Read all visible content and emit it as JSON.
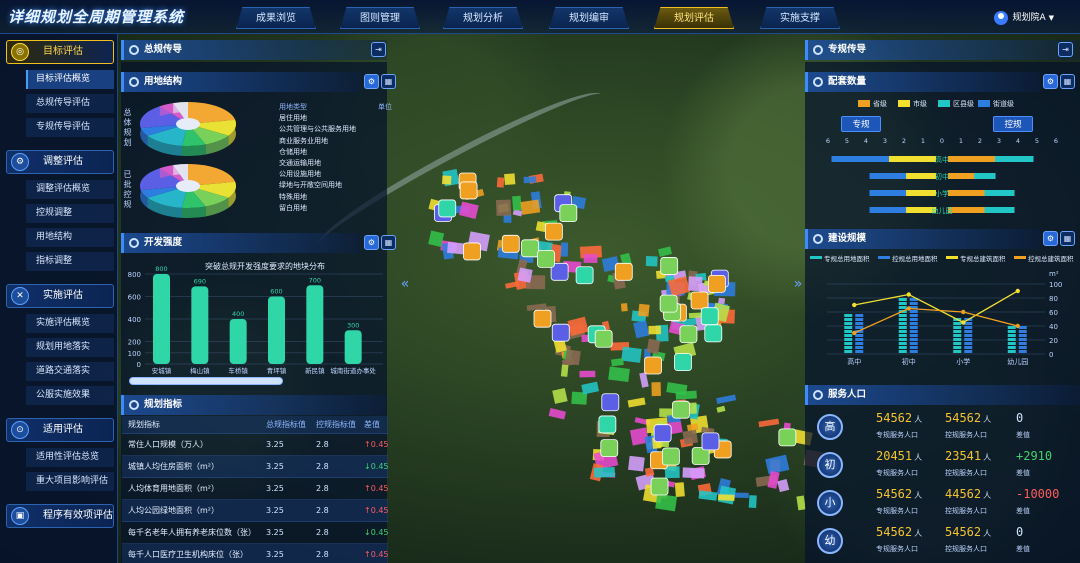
{
  "app_title": "详细规划全周期管理系统",
  "nav": [
    "成果浏览",
    "图则管理",
    "规划分析",
    "规划编审",
    "规划评估",
    "实施支撑"
  ],
  "nav_active": 4,
  "user": "规划院A",
  "sidebar": [
    {
      "label": "目标评估",
      "icon": "target-icon",
      "glyph": "◎",
      "active": true,
      "items": [
        "目标评估概览",
        "总规传导评估",
        "专规传导评估"
      ],
      "active_item": 0
    },
    {
      "label": "调整评估",
      "icon": "adjust-icon",
      "glyph": "⚙",
      "active": false,
      "items": [
        "调整评估概览",
        "控规调整",
        "用地结构",
        "指标调整"
      ]
    },
    {
      "label": "实施评估",
      "icon": "tools-icon",
      "glyph": "✕",
      "active": false,
      "items": [
        "实施评估概览",
        "规划用地落实",
        "道路交通落实",
        "公服实施效果"
      ]
    },
    {
      "label": "适用评估",
      "icon": "fit-icon",
      "glyph": "⊙",
      "active": false,
      "items": [
        "适用性评估总览",
        "重大项目影响评估"
      ]
    },
    {
      "label": "程序有效项评估",
      "icon": "process-icon",
      "glyph": "▣",
      "active": false,
      "items": []
    }
  ],
  "left": {
    "zongguiheader": "总规传导",
    "landuse_header": "用地结构",
    "pie_label_top": "总体规划",
    "pie_label_bottom": "已批控规",
    "legend_heading": "用地类型",
    "legend_value_heading": "单位",
    "land_types": [
      "居住用地",
      "公共管理与公共服务用地",
      "商业服务业用地",
      "仓储用地",
      "交通运输用地",
      "公用设施用地",
      "绿地与开敞空间用地",
      "特殊用地",
      "留白用地"
    ],
    "intensity_header": "开发强度",
    "intensity_title": "突破总规开发强度要求的地块分布",
    "kpi_header": "规划指标",
    "kpi_columns": [
      "规划指标",
      "总规指标值",
      "控规指标值",
      "差值"
    ],
    "kpi_rows": [
      {
        "name": "常住人口规模（万人）",
        "a": "3.25",
        "b": "2.8",
        "diff": "0.45",
        "trend": "up"
      },
      {
        "name": "城镇人均住房面积（m²）",
        "a": "3.25",
        "b": "2.8",
        "diff": "0.45",
        "trend": "down"
      },
      {
        "name": "人均体育用地面积（m²）",
        "a": "3.25",
        "b": "2.8",
        "diff": "0.45",
        "trend": "up"
      },
      {
        "name": "人均公园绿地面积（m²）",
        "a": "3.25",
        "b": "2.8",
        "diff": "0.45",
        "trend": "up"
      },
      {
        "name": "每千名老年人拥有养老床位数（张）",
        "a": "3.25",
        "b": "2.8",
        "diff": "0.45",
        "trend": "down"
      },
      {
        "name": "每千人口医疗卫生机构床位（张）",
        "a": "3.25",
        "b": "2.8",
        "diff": "0.45",
        "trend": "up"
      }
    ]
  },
  "right": {
    "zhuangui_header": "专规传导",
    "supply_header": "配套数量",
    "supply_legend": [
      {
        "name": "省级",
        "color": "#f0a020"
      },
      {
        "name": "市级",
        "color": "#f2e030"
      },
      {
        "name": "区县级",
        "color": "#22c6c6"
      },
      {
        "name": "街道级",
        "color": "#2e7de0"
      }
    ],
    "btn_left": "专规",
    "btn_right": "控规",
    "scale_ticks": [
      "6",
      "5",
      "4",
      "3",
      "2",
      "1",
      "0",
      "1",
      "2",
      "3",
      "4",
      "5",
      "6"
    ],
    "school_levels": [
      "高中",
      "初中",
      "小学",
      "幼儿园"
    ],
    "scale_header": "建设规模",
    "scale_legend": [
      "专规总用地面积",
      "控规总用地面积",
      "专规总建筑面积",
      "控规总建筑面积"
    ],
    "scale_unit_left": "m²",
    "service_header": "服务人口",
    "service_rows": [
      {
        "badge": "高",
        "a": "54562",
        "b": "54562",
        "diff": "0",
        "diff_color": "#cfe3ff"
      },
      {
        "badge": "初",
        "a": "20451",
        "b": "23541",
        "diff": "+2910",
        "diff_color": "#3fd36b"
      },
      {
        "badge": "小",
        "a": "54562",
        "b": "44562",
        "diff": "-10000",
        "diff_color": "#ff5c5c"
      },
      {
        "badge": "幼",
        "a": "54562",
        "b": "54562",
        "diff": "0",
        "diff_color": "#cfe3ff"
      }
    ],
    "unit": "人",
    "label_a": "专规服务人口",
    "label_b": "控规服务人口",
    "label_diff": "差值"
  },
  "chart_data": [
    {
      "type": "bar",
      "title": "突破总规开发强度要求的地块分布",
      "categories": [
        "安城镇",
        "梅山镇",
        "车桥镇",
        "青坪镇",
        "新民镇",
        "城南街道办事处"
      ],
      "values": [
        800,
        690,
        400,
        600,
        700,
        300
      ],
      "ylim": [
        0,
        800
      ],
      "yticks": [
        0,
        100,
        200,
        400,
        600,
        800
      ]
    },
    {
      "type": "bar",
      "title": "配套数量",
      "orientation": "horizontal-diverging",
      "categories": [
        "高中",
        "初中",
        "小学",
        "幼儿园"
      ],
      "series": [
        {
          "name": "专规",
          "values": [
            5.5,
            3.5,
            3.5,
            3.5
          ]
        },
        {
          "name": "控规",
          "values": [
            4.5,
            2.5,
            3.5,
            3.5
          ]
        }
      ],
      "xlim": [
        -6,
        6
      ]
    },
    {
      "type": "bar",
      "title": "建设规模",
      "categories": [
        "高中",
        "初中",
        "小学",
        "幼儿园"
      ],
      "series": [
        {
          "name": "专规总用地面积",
          "values": [
            60,
            80,
            55,
            40
          ]
        },
        {
          "name": "控规总用地面积",
          "values": [
            60,
            80,
            55,
            40
          ]
        },
        {
          "name": "专规总建筑面积",
          "values": [
            70,
            85,
            45,
            90
          ]
        },
        {
          "name": "控规总建筑面积",
          "values": [
            30,
            65,
            60,
            40
          ]
        }
      ],
      "ylim": [
        0,
        100
      ],
      "yticks": [
        0,
        20,
        40,
        60,
        80,
        100
      ]
    },
    {
      "type": "pie",
      "title": "用地结构",
      "categories": [
        "居住用地",
        "公共管理与公共服务用地",
        "商业服务业用地",
        "仓储用地",
        "交通运输用地",
        "公用设施用地",
        "绿地与开敞空间用地",
        "特殊用地",
        "留白用地"
      ],
      "values": [
        22,
        12,
        10,
        8,
        14,
        6,
        18,
        5,
        5
      ],
      "colors": [
        "#f2a833",
        "#e9e133",
        "#7ad15a",
        "#2fc46b",
        "#27b6c9",
        "#2e7de0",
        "#5a5fe6",
        "#d75ac9",
        "#e2e2f0"
      ]
    }
  ]
}
